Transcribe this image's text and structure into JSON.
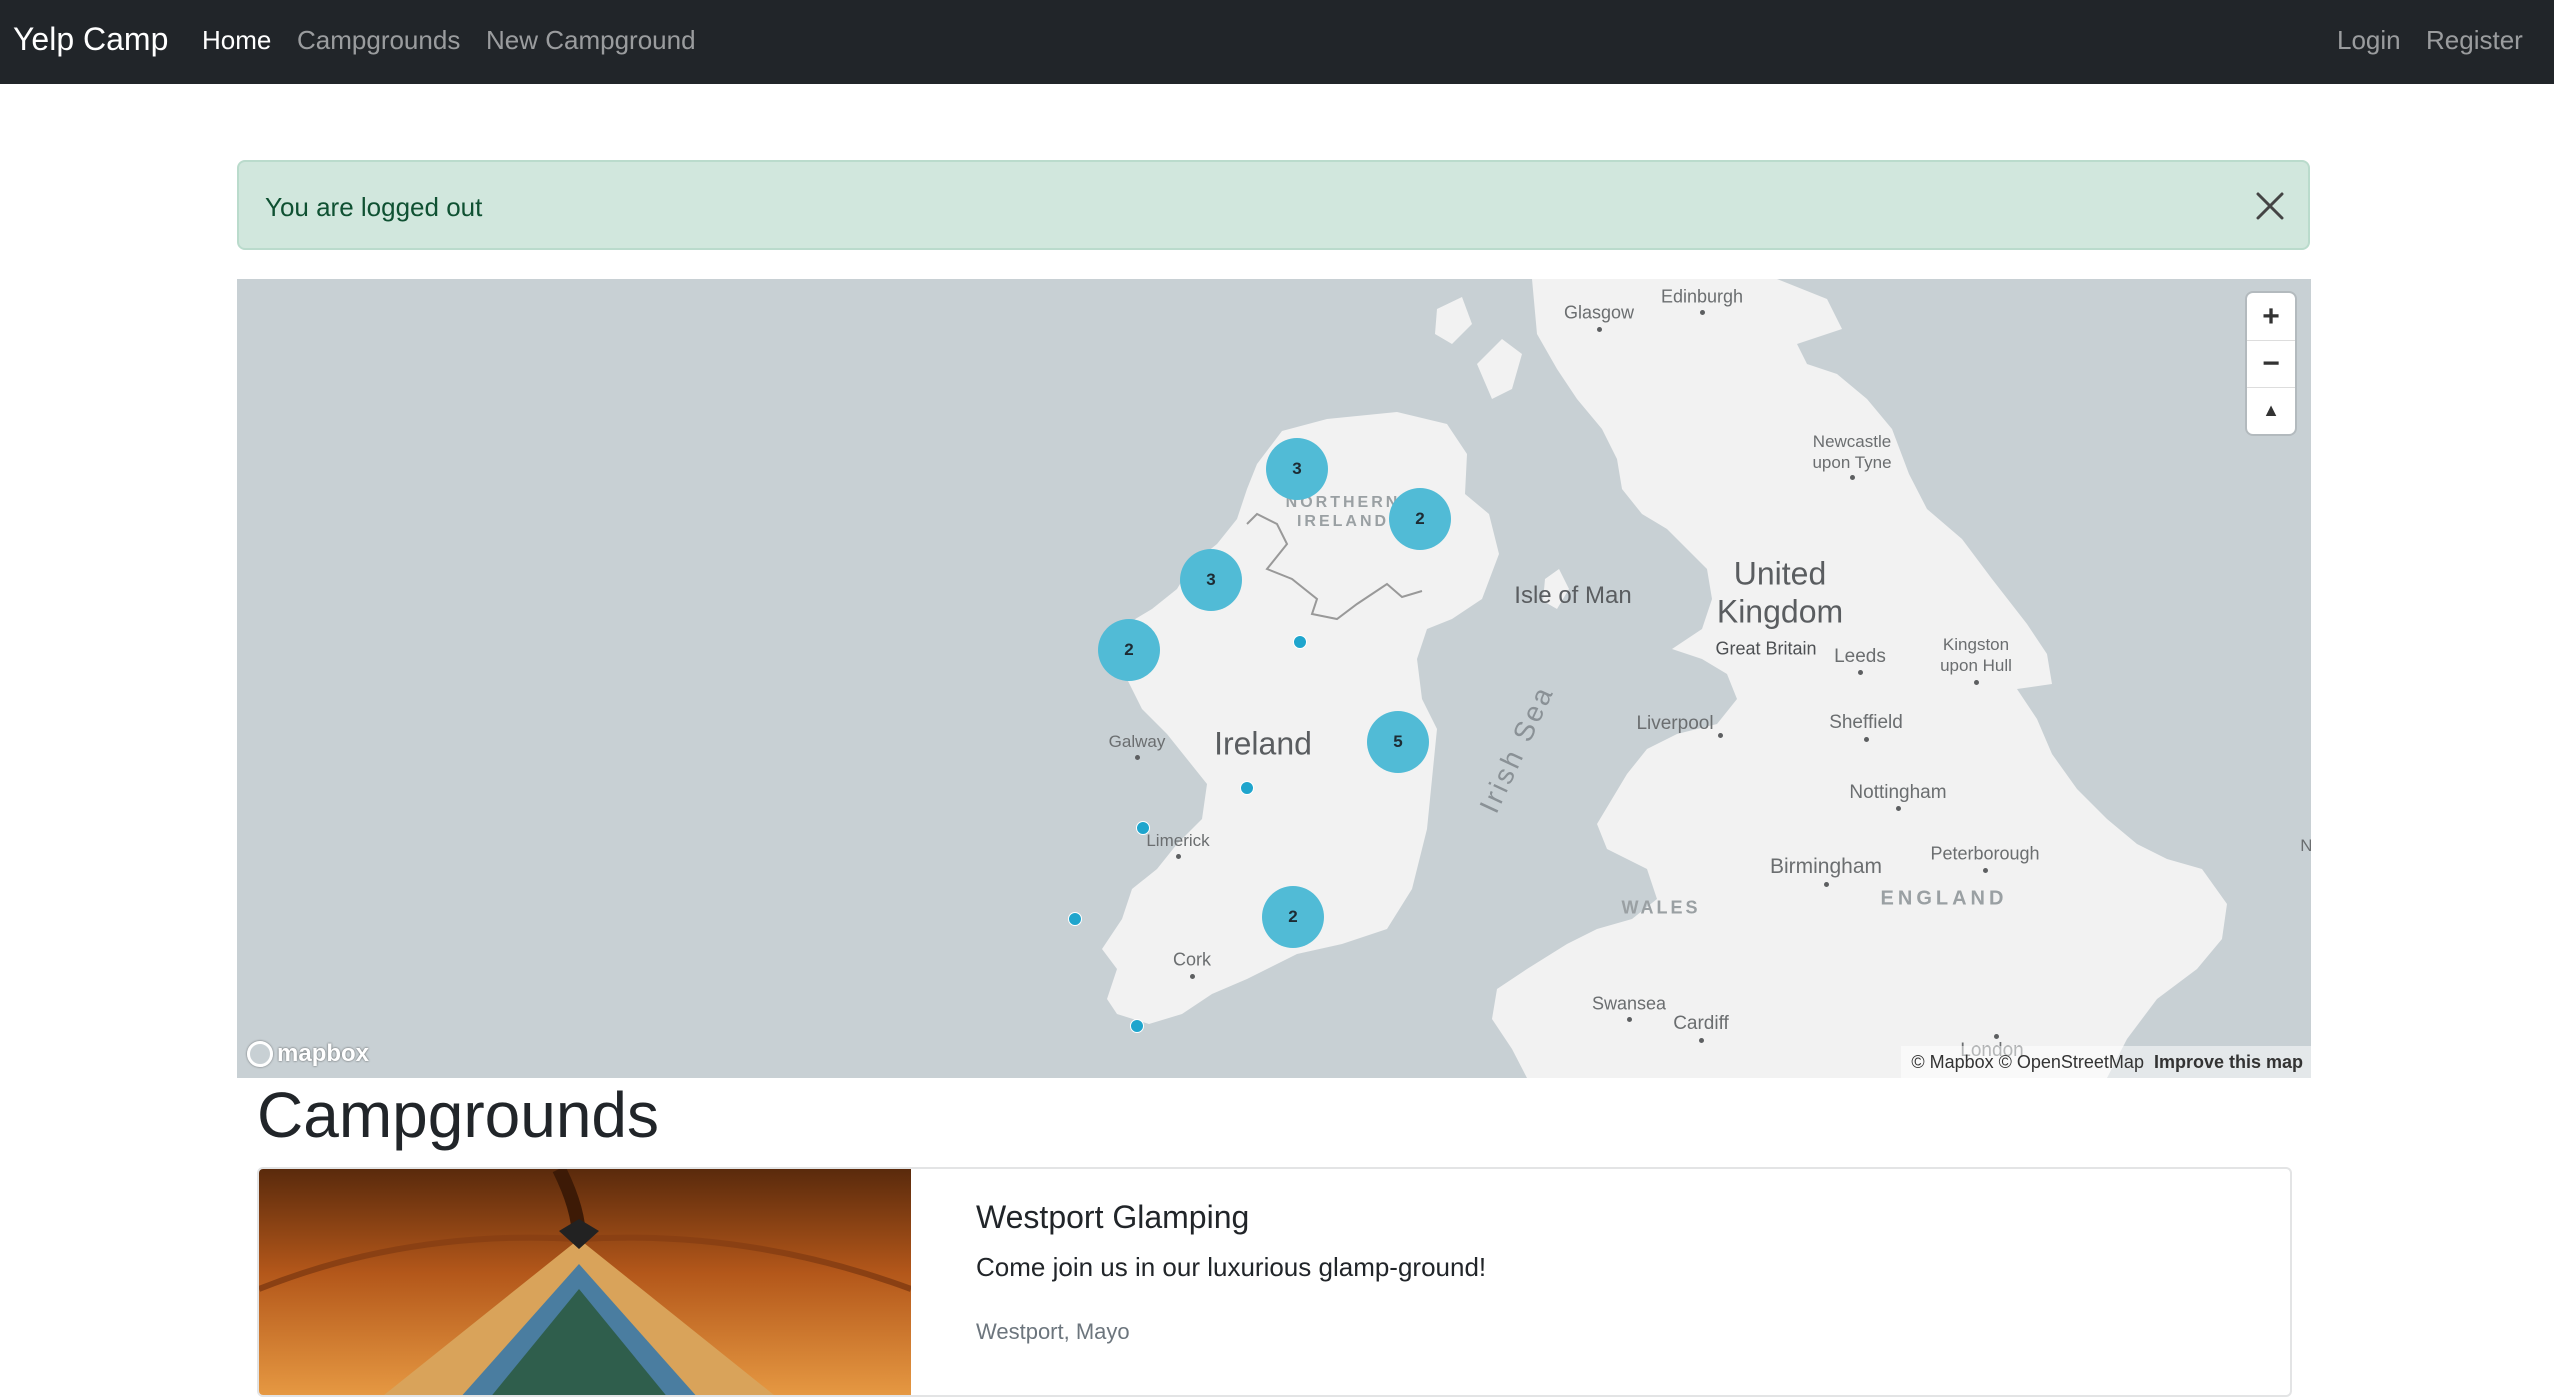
{
  "navbar": {
    "brand": "Yelp Camp",
    "links": [
      "Home",
      "Campgrounds",
      "New Campground"
    ],
    "active": "Home",
    "auth": [
      "Login",
      "Register"
    ]
  },
  "alert": {
    "message": "You are logged out",
    "type": "success"
  },
  "map": {
    "clusters": [
      {
        "count": "3"
      },
      {
        "count": "2"
      },
      {
        "count": "3"
      },
      {
        "count": "2"
      },
      {
        "count": "5"
      },
      {
        "count": "2"
      }
    ],
    "labels": {
      "glasgow": "Glasgow",
      "edinburgh": "Edinburgh",
      "newcastle1": "Newcastle",
      "newcastle2": "upon Tyne",
      "northern1": "NORTHERN",
      "northern2": "IRELAND",
      "isle_of_man": "Isle of Man",
      "united": "United",
      "kingdom": "Kingdom",
      "great_britain": "Great Britain",
      "leeds": "Leeds",
      "kingston1": "Kingston",
      "kingston2": "upon Hull",
      "irish_sea": "Irish Sea",
      "liverpool": "Liverpool",
      "sheffield": "Sheffield",
      "galway": "Galway",
      "ireland": "Ireland",
      "limerick": "Limerick",
      "nottingham": "Nottingham",
      "norwich": "Norwich",
      "peterborough": "Peterborough",
      "birmingham": "Birmingham",
      "wales": "WALES",
      "england": "ENGLAND",
      "cork": "Cork",
      "swansea": "Swansea",
      "cardiff": "Cardiff",
      "london": "London"
    },
    "zoom_in": "+",
    "zoom_out": "−",
    "compass": "▲",
    "logo": "mapbox",
    "attribution": "© Mapbox © OpenStreetMap",
    "improve": "Improve this map"
  },
  "campgrounds": {
    "title": "Campgrounds",
    "items": [
      {
        "name": "Westport Glamping",
        "description": "Come join us in our luxurious glamp-ground!",
        "location": "Westport, Mayo"
      }
    ]
  },
  "colors": {
    "navbar": "#212529",
    "alert_bg": "#d1e7dd",
    "alert_text": "#0f5132",
    "cluster": "#51bbd6",
    "point": "#1fa5cd",
    "water": "#c8d0d4",
    "land": "#f2f2f2"
  }
}
